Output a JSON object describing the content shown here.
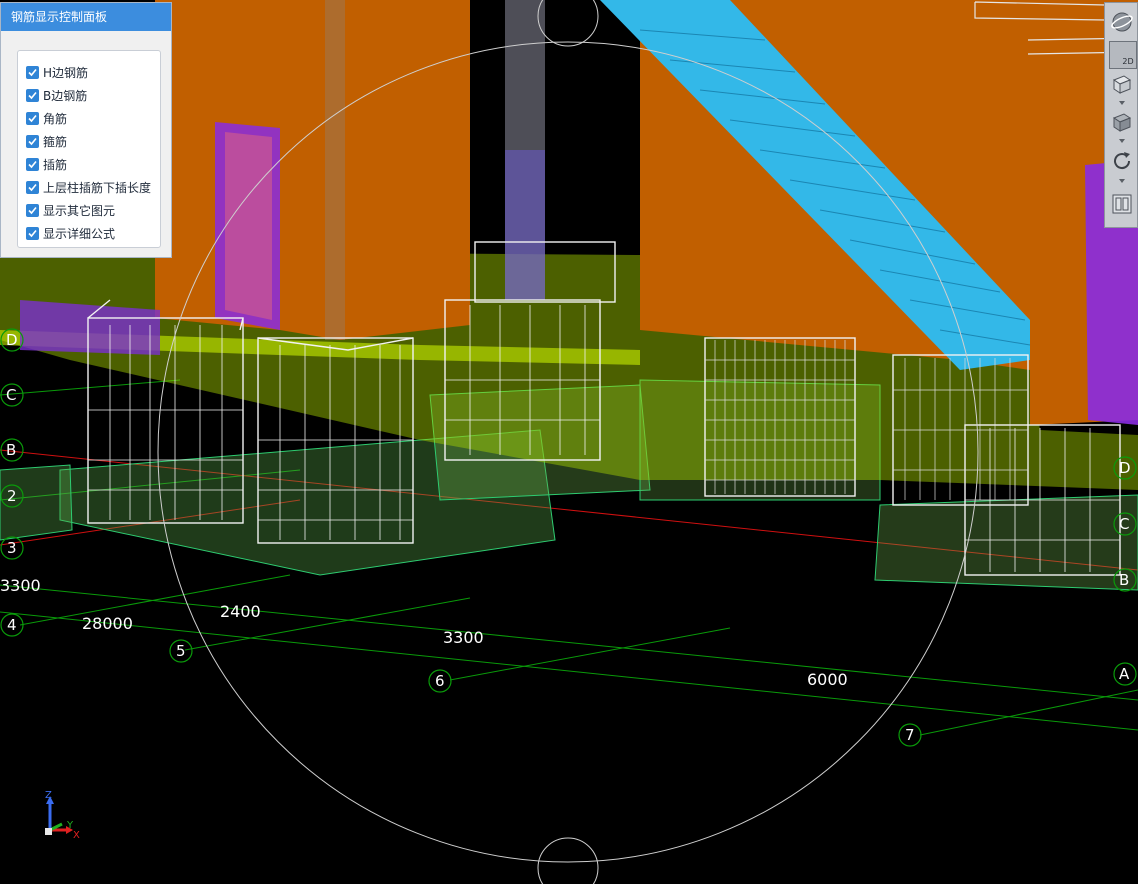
{
  "panel": {
    "title": "钢筋显示控制面板",
    "options": [
      {
        "label": "H边钢筋",
        "checked": true
      },
      {
        "label": "B边钢筋",
        "checked": true
      },
      {
        "label": "角筋",
        "checked": true
      },
      {
        "label": "箍筋",
        "checked": true
      },
      {
        "label": "插筋",
        "checked": true
      },
      {
        "label": "上层柱插筋下插长度",
        "checked": true
      },
      {
        "label": "显示其它图元",
        "checked": true
      },
      {
        "label": "显示详细公式",
        "checked": true
      }
    ]
  },
  "toolbar": {
    "buttons": [
      {
        "name": "orbit-icon"
      },
      {
        "name": "view-2d-icon",
        "label": "2D"
      },
      {
        "name": "view-3d-box-icon"
      },
      {
        "name": "solid-box-icon"
      },
      {
        "name": "rotate-icon"
      },
      {
        "name": "layer-panel-icon"
      }
    ]
  },
  "grid_labels": {
    "axes": [
      "D",
      "C",
      "B",
      "2",
      "3",
      "4",
      "5",
      "6",
      "7",
      "A",
      "D",
      "C",
      "B"
    ],
    "dimensions": [
      "3300",
      "28000",
      "2400",
      "3300",
      "6000"
    ]
  },
  "gizmo": {
    "z": "Z",
    "y": "Y",
    "x": "X"
  },
  "colors": {
    "wall": "#c15f00",
    "stair": "#33b8e8",
    "slab": "#a8d400",
    "footing": "#6fbf6a",
    "rebar": "#ffffff",
    "grid": "#00a000",
    "panel_title": "#3c8dde",
    "checkbox": "#2f84d6"
  }
}
